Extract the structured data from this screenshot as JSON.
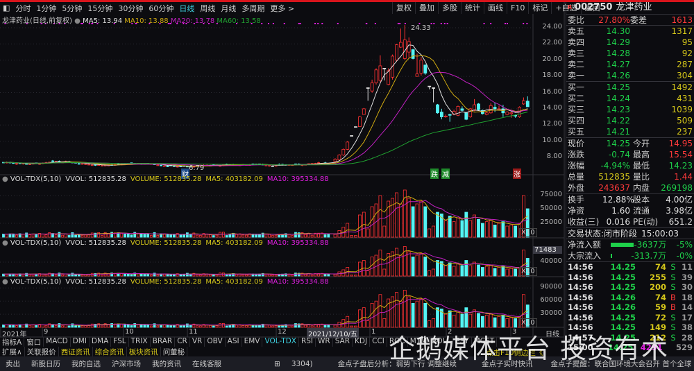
{
  "toolbar": {
    "periods": [
      "分时",
      "1分钟",
      "5分钟",
      "15分钟",
      "30分钟",
      "60分钟",
      "日线",
      "周线",
      "月线",
      "多周期",
      "更多 >"
    ],
    "active": "日线",
    "right": [
      "复权",
      "叠加",
      "多股",
      "统计",
      "画线",
      "F10",
      "标记",
      "+自选",
      "返回"
    ]
  },
  "main": {
    "title": "龙津药业(日线,前复权)",
    "ma5": "MA5: 13.94",
    "ma10": "MA10: 13.88",
    "ma20": "MA20: 13.78",
    "ma60": "MA60: 13.58",
    "high_label": "24.33",
    "low_label": "6.79",
    "badge_cai": "财",
    "badge_die": "跌",
    "badge_jian": "减",
    "badge_zhang": "涨",
    "price_ticks": [
      24,
      22,
      20,
      18,
      16,
      14,
      12,
      10,
      8
    ]
  },
  "colors": {
    "up": "#ff3232",
    "down": "#54f4f4",
    "ma5": "#e0e0e0",
    "ma10": "#d0aa10",
    "ma20": "#c020c0",
    "ma60": "#20a030"
  },
  "candles": [
    [
      7.5,
      7.8,
      7.9,
      7.4,
      5000
    ],
    [
      7.7,
      8.3,
      8.4,
      7.6,
      12000
    ],
    [
      8.3,
      9.0,
      9.1,
      8.2,
      18000
    ],
    [
      9.0,
      9.9,
      10.0,
      8.9,
      25000
    ],
    [
      10.7,
      10.7,
      10.7,
      10.7,
      3000
    ],
    [
      11.8,
      11.8,
      11.8,
      11.8,
      3000
    ],
    [
      11.8,
      13.0,
      13.1,
      11.8,
      40000
    ],
    [
      13.3,
      14.0,
      14.1,
      13.3,
      45000
    ],
    [
      16.6,
      16.6,
      16.6,
      15.0,
      15000
    ],
    [
      16.2,
      17.2,
      17.6,
      16.0,
      55000
    ],
    [
      17.2,
      18.8,
      19.0,
      17.0,
      60000
    ],
    [
      17.5,
      19.3,
      20.6,
      17.3,
      75000
    ],
    [
      19.0,
      19.0,
      19.0,
      17.5,
      20000
    ],
    [
      17.0,
      18.7,
      19.0,
      16.9,
      65000
    ],
    [
      17.9,
      20.5,
      20.7,
      17.6,
      70000
    ],
    [
      20.0,
      21.9,
      22.0,
      19.8,
      80000
    ],
    [
      21.6,
      22.2,
      23.9,
      21.5,
      60000
    ],
    [
      20.2,
      22.5,
      24.33,
      20.0,
      85000
    ],
    [
      21.0,
      22.3,
      22.8,
      20.3,
      70000
    ],
    [
      21.3,
      20.2,
      21.4,
      20.1,
      55000
    ],
    [
      18.0,
      18.3,
      20.8,
      18.0,
      60000
    ],
    [
      18.4,
      20.0,
      20.4,
      18.1,
      65000
    ],
    [
      19.4,
      18.4,
      19.5,
      18.2,
      55000
    ],
    [
      16.8,
      16.8,
      16.8,
      16.4,
      15000
    ],
    [
      16.6,
      16.6,
      16.6,
      14.8,
      20000
    ],
    [
      14.5,
      13.5,
      14.6,
      13.4,
      45000
    ],
    [
      13.6,
      13.0,
      14.0,
      12.7,
      42000
    ],
    [
      13.0,
      13.1,
      13.3,
      12.9,
      30000
    ],
    [
      13.3,
      13.2,
      13.4,
      12.4,
      38000
    ],
    [
      13.3,
      13.7,
      13.9,
      13.2,
      28000
    ],
    [
      13.2,
      14.3,
      14.4,
      13.1,
      35000
    ],
    [
      14.0,
      13.8,
      14.3,
      13.7,
      30000
    ],
    [
      13.5,
      12.7,
      13.6,
      12.6,
      45000
    ],
    [
      13.0,
      14.0,
      14.1,
      12.9,
      30000
    ],
    [
      13.8,
      14.5,
      15.2,
      13.7,
      40000
    ],
    [
      14.6,
      13.9,
      14.7,
      13.8,
      32000
    ],
    [
      13.8,
      13.4,
      13.9,
      13.3,
      25000
    ],
    [
      13.3,
      13.5,
      13.6,
      13.2,
      28000
    ],
    [
      13.5,
      14.4,
      14.7,
      13.4,
      30000
    ],
    [
      14.2,
      14.0,
      14.8,
      13.6,
      22000
    ],
    [
      13.9,
      14.0,
      14.4,
      13.8,
      25000
    ],
    [
      14.0,
      13.5,
      14.5,
      13.0,
      28000
    ],
    [
      13.3,
      13.6,
      13.7,
      13.2,
      20000
    ],
    [
      13.4,
      13.5,
      13.6,
      12.9,
      22000
    ],
    [
      13.2,
      13.1,
      13.3,
      12.9,
      20000
    ],
    [
      13.0,
      14.2,
      14.3,
      12.9,
      25000
    ],
    [
      14.6,
      15.0,
      15.4,
      14.5,
      75000
    ],
    [
      14.95,
      14.25,
      15.54,
      14.23,
      51284
    ]
  ],
  "vol": {
    "head": "VOL-TDX(5,10)",
    "vvol": "VVOL: 512835.28",
    "volume": "VOLUME: 512835.28",
    "ma5": "MA5: 403182.09",
    "ma10": "MA10: 395334.88",
    "pane1_ticks": [
      "75000",
      "50000",
      "25000"
    ],
    "pane2_ticks": [
      "71483",
      "40000"
    ],
    "pane3_ticks": [
      "90000",
      "60000",
      "30000"
    ],
    "unit": "X10"
  },
  "dates": {
    "labels": [
      "2021年",
      "9",
      "10",
      "11",
      "12",
      "1",
      "2",
      "3"
    ],
    "cursor": "2021/12/10/五",
    "period": "日线"
  },
  "indicators": [
    "指标A",
    "窗口",
    "MACD",
    "DMI",
    "DMA",
    "FSL",
    "TRIX",
    "BRAR",
    "CR",
    "VR",
    "OBV",
    "ASI",
    "EMV",
    "VOL-TDX",
    "RSI",
    "WR",
    "SAR",
    "KDJ",
    "CCI",
    "ROC",
    "MTM",
    "BOLL",
    "PSY",
    "MCST"
  ],
  "indicator_active": "VOL-TDX",
  "ext": [
    "扩展∧",
    "关联报价",
    "西证资讯",
    "综合资讯",
    "板块资讯",
    "问董秘"
  ],
  "ext_hint": "点击F10侧边栏《",
  "quote": {
    "flag": "R",
    "code": "002750",
    "name": "龙津药业",
    "weibi_label": "委比",
    "weibi": "27.80%",
    "weicha_label": "委差",
    "weicha": "1613",
    "sell": [
      [
        "卖五",
        "14.30",
        "1317"
      ],
      [
        "卖四",
        "14.29",
        "95"
      ],
      [
        "卖三",
        "14.28",
        "92"
      ],
      [
        "卖二",
        "14.27",
        "287"
      ],
      [
        "卖一",
        "14.26",
        "304"
      ]
    ],
    "buy": [
      [
        "买一",
        "14.25",
        "1492"
      ],
      [
        "买二",
        "14.24",
        "431"
      ],
      [
        "买三",
        "14.23",
        "1039"
      ],
      [
        "买四",
        "14.22",
        "509"
      ],
      [
        "买五",
        "14.21",
        "237"
      ]
    ],
    "stats1": [
      [
        "现价",
        "14.25",
        "今开",
        "14.95",
        "g",
        "r"
      ],
      [
        "涨跌",
        "-0.74",
        "最高",
        "15.54",
        "g",
        "r"
      ],
      [
        "涨幅",
        "-4.94%",
        "最低",
        "14.23",
        "g",
        "g"
      ],
      [
        "总量",
        "512835",
        "量比",
        "1.44",
        "y",
        "r"
      ],
      [
        "外盘",
        "243637",
        "内盘",
        "269198",
        "r",
        "g"
      ]
    ],
    "stats2": [
      [
        "换手",
        "12.88%",
        "股本",
        "4.00亿"
      ],
      [
        "净资",
        "1.60",
        "流通",
        "3.98亿"
      ],
      [
        "收益(三)",
        "0.016",
        "PE(动)",
        "651.2"
      ]
    ],
    "status_label": "交易状态:",
    "status_value": "闭市阶段",
    "status_time": "15:00:03",
    "flow": [
      [
        "净流入额",
        "-3637万",
        "-5%"
      ],
      [
        "大宗流入",
        "-313.7万",
        "-0%"
      ]
    ],
    "ticks": [
      [
        "14:56",
        "14.25",
        "74",
        "S",
        "11"
      ],
      [
        "14:56",
        "14.25",
        "255",
        "S",
        "39"
      ],
      [
        "14:56",
        "14.25",
        "200",
        "S",
        "30"
      ],
      [
        "14:56",
        "14.26",
        "74",
        "B",
        "18"
      ],
      [
        "14:56",
        "14.26",
        "59",
        "B",
        "14"
      ],
      [
        "14:56",
        "14.25",
        "72",
        "S",
        "17"
      ],
      [
        "14:56",
        "14.25",
        "149",
        "S",
        "38"
      ],
      [
        "14:57",
        "14.25",
        "212",
        "S",
        "28"
      ],
      [
        "15:00",
        "14.25",
        "4291",
        "",
        "529"
      ]
    ]
  },
  "status": {
    "items": [
      "卖出",
      "新股日历",
      "我的自选",
      "沪深市场",
      "我的资讯",
      "在线客服"
    ],
    "code_tail": "3304)",
    "news1": "金点子盘后分析：弱势下行  调整继续",
    "news2": "金点子实时快讯",
    "news3": "金点子提醒：联合国环境大会召开 首个全球"
  },
  "watermark": "企鹅媒体平台 投资有术"
}
